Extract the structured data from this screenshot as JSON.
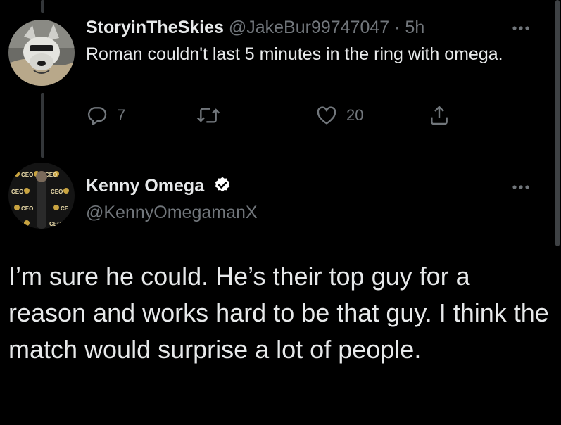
{
  "reply_tweet": {
    "display_name": "StoryinTheSkies",
    "handle": "@JakeBur99747047",
    "separator": "·",
    "timestamp": "5h",
    "text": "Roman couldn't last 5 minutes in the ring with omega.",
    "actions": {
      "reply_count": "7",
      "retweet_count": "",
      "like_count": "20"
    },
    "avatar_icon": "wolf-avatar"
  },
  "main_tweet": {
    "display_name": "Kenny Omega",
    "handle": "@KennyOmegamanX",
    "verified_icon": "verified-badge-icon",
    "text": "I’m sure he could. He’s their top guy for a reason and works hard to be that guy. I think the match would surprise a lot of people.",
    "avatar_icon": "ceo-backdrop-avatar"
  },
  "colors": {
    "background": "#000000",
    "primary_text": "#e7e9ea",
    "secondary_text": "#71767b",
    "thread_line": "#333639"
  }
}
